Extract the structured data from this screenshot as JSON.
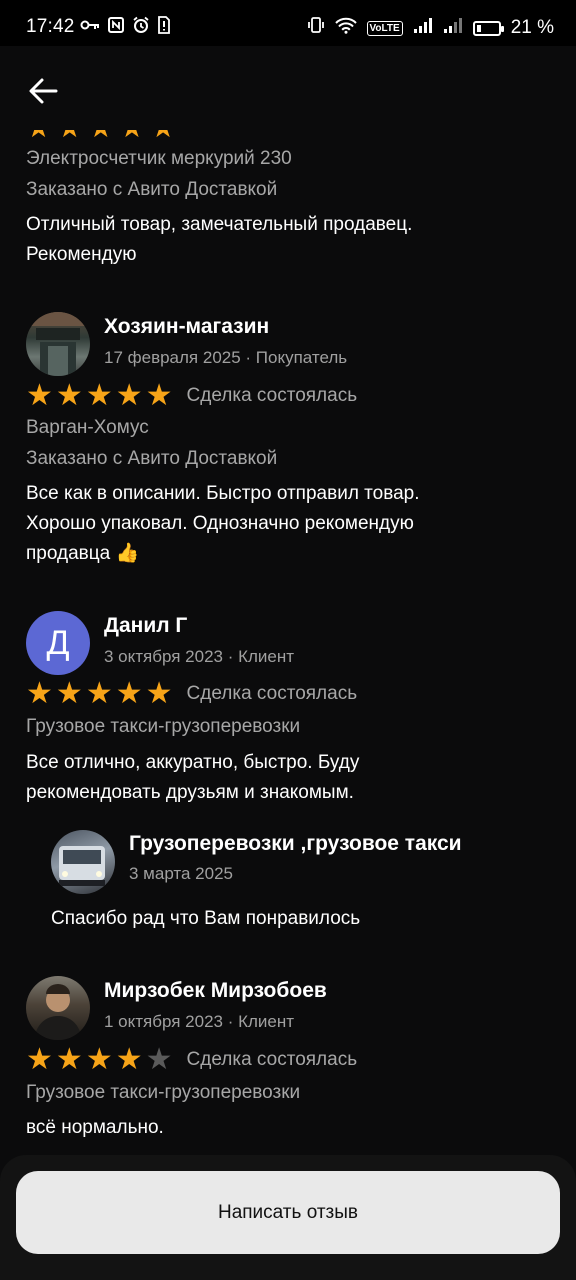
{
  "status_bar": {
    "time": "17:42",
    "battery_percent": "21 %",
    "battery_level": 0.21,
    "left_icons": [
      "key-icon",
      "nfc-icon",
      "alarm-icon",
      "sim-alert-icon"
    ],
    "right_icons": [
      "vibrate-icon",
      "wifi-icon",
      "volte-icon",
      "signal-icon",
      "signal-icon",
      "battery-icon"
    ],
    "volte_label": "VoLTE"
  },
  "header": {
    "back_icon": "arrow-left-icon"
  },
  "reviews": [
    {
      "partial_top": true,
      "rating": 5,
      "item": "Электросчетчик меркурий 230",
      "delivery": "Заказано с Авито Доставкой",
      "text": "Отличный товар, замечательный продавец. Рекомендую"
    },
    {
      "author": "Хозяин-магазин",
      "date": "17 февраля 2025",
      "role": "Покупатель",
      "rating": 5,
      "deal": "Сделка состоялась",
      "item": "Варган-Хомус",
      "delivery": "Заказано с Авито Доставкой",
      "text_line1": "Все как в описании. Быстро отправил товар.",
      "text_line2": "Хорошо упаковал. Однозначно рекомендую",
      "text_line3": "продавца 👍"
    },
    {
      "author": "Данил Г",
      "avatar_letter": "Д",
      "date": "3 октября 2023",
      "role": "Клиент",
      "rating": 5,
      "deal": "Сделка состоялась",
      "item": "Грузовое такси-грузоперевозки",
      "text_line1": "Все отлично, аккуратно, быстро.  Буду",
      "text_line2": "рекомендовать друзьям и знакомым.",
      "reply": {
        "author": "Грузоперевозки ,грузовое такси",
        "date": "3 марта 2025",
        "text": "Спасибо рад что Вам понравилось"
      }
    },
    {
      "author": "Мирзобек Мирзобоев",
      "date": "1 октября 2023",
      "role": "Клиент",
      "rating": 4,
      "deal": "Сделка состоялась",
      "item": "Грузовое такси-грузоперевозки",
      "text": "всё нормально."
    }
  ],
  "bottom": {
    "write_review_label": "Написать отзыв"
  },
  "colors": {
    "star_on": "#f7a418",
    "star_off": "#5a5a5a",
    "avatar_letter_bg": "#5c68d4",
    "background": "#0b0b0c"
  }
}
